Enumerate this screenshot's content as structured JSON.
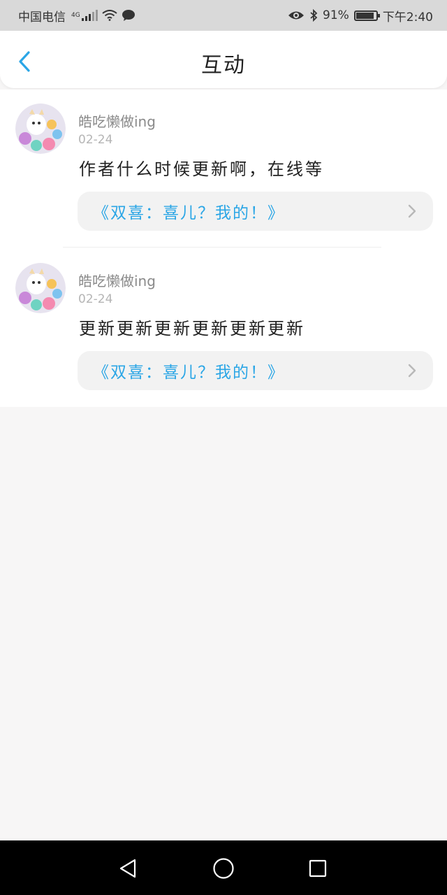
{
  "status_bar": {
    "carrier": "中国电信",
    "network_type": "4G",
    "battery_percent": "91%",
    "battery_level": 0.91,
    "time": "下午2:40",
    "icons": [
      "signal-icon",
      "wifi-icon",
      "chat-icon",
      "eye-icon",
      "bluetooth-icon",
      "battery-icon"
    ]
  },
  "header": {
    "title": "互动",
    "back_icon": "chevron-left-icon"
  },
  "items": [
    {
      "username": "皓吃懒做ing",
      "date": "02-24",
      "comment": "作者什么时候更新啊，在线等",
      "book_title": "《双喜：喜儿？我的！》"
    },
    {
      "username": "皓吃懒做ing",
      "date": "02-24",
      "comment": "更新更新更新更新更新更新",
      "book_title": "《双喜：喜儿？我的！》"
    }
  ],
  "colors": {
    "accent": "#2ba6e6",
    "page_background": "#f7f6f6",
    "status_bar": "#d9d9d9"
  },
  "nav_bar": {
    "icons": [
      "back-triangle-icon",
      "home-circle-icon",
      "recents-square-icon"
    ]
  }
}
